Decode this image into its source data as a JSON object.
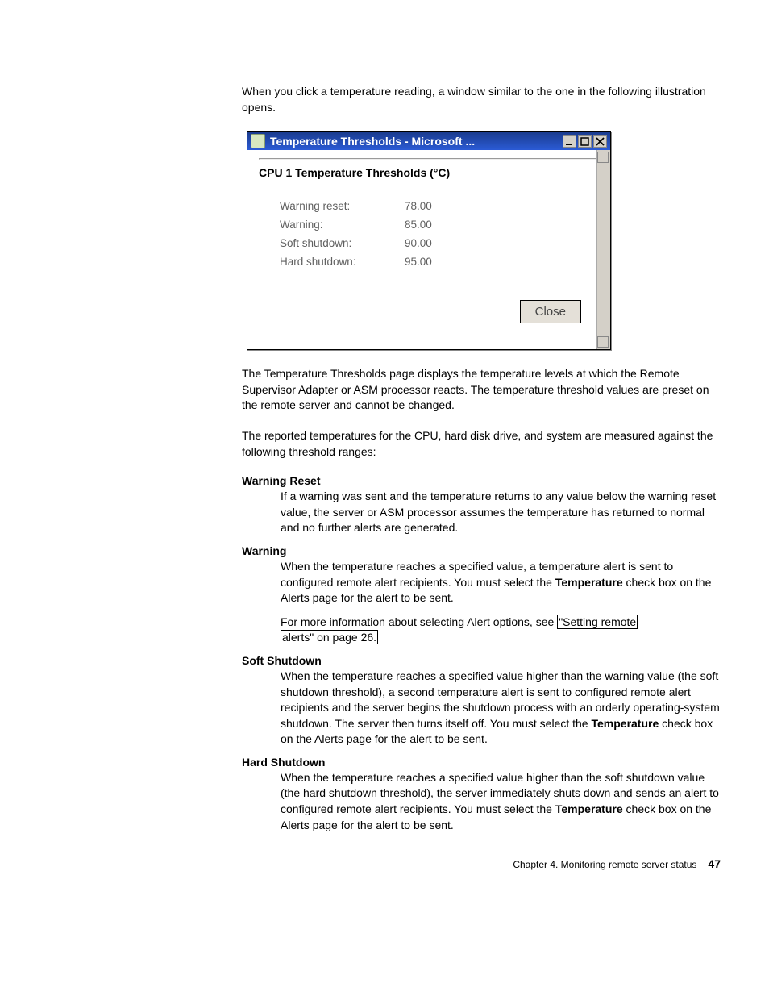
{
  "intro_text": "When you click a temperature reading, a window similar to the one in the following illustration opens.",
  "dialog": {
    "title": "Temperature Thresholds - Microsoft ...",
    "heading": "CPU 1 Temperature Thresholds (°C)",
    "rows": [
      {
        "label": "Warning reset:",
        "value": "78.00"
      },
      {
        "label": "Warning:",
        "value": "85.00"
      },
      {
        "label": "Soft shutdown:",
        "value": "90.00"
      },
      {
        "label": "Hard shutdown:",
        "value": "95.00"
      }
    ],
    "close_label": "Close"
  },
  "paragraphs": {
    "after1": "The Temperature Thresholds page displays the temperature levels at which the Remote Supervisor Adapter or ASM processor reacts. The temperature threshold values are preset on the remote server and cannot be changed.",
    "after2": "The reported temperatures for the CPU, hard disk drive, and system are measured against the following threshold ranges:"
  },
  "defs": {
    "warning_reset": {
      "term": "Warning Reset",
      "body": "If a warning was sent and the temperature returns to any value below the warning reset value, the server or ASM processor assumes the temperature has returned to normal and no further alerts are generated."
    },
    "warning": {
      "term": "Warning",
      "p1a": "When the temperature reaches a specified value, a temperature alert is sent to configured remote alert recipients. You must select the ",
      "p1b": "Temperature",
      "p1c": " check box on the Alerts page for the alert to be sent.",
      "p2a": "For more information about selecting Alert options, see ",
      "link1": "\"Setting remote",
      "link2": "alerts\" on page 26.",
      "p2b": ""
    },
    "soft_shutdown": {
      "term": "Soft Shutdown",
      "b1": "When the temperature reaches a specified value higher than the warning value (the soft shutdown threshold), a second temperature alert is sent to configured remote alert recipients and the server begins the shutdown process with an orderly operating-system shutdown. The server then turns itself off. You must select the ",
      "b2": "Temperature",
      "b3": " check box on the Alerts page for the alert to be sent."
    },
    "hard_shutdown": {
      "term": "Hard Shutdown",
      "b1": "When the temperature reaches a specified value higher than the soft shutdown value (the hard shutdown threshold), the server immediately shuts down and sends an alert to configured remote alert recipients. You must select the ",
      "b2": "Temperature",
      "b3": " check box on the Alerts page for the alert to be sent."
    }
  },
  "footer": {
    "chapter": "Chapter 4. Monitoring remote server status",
    "page": "47"
  }
}
